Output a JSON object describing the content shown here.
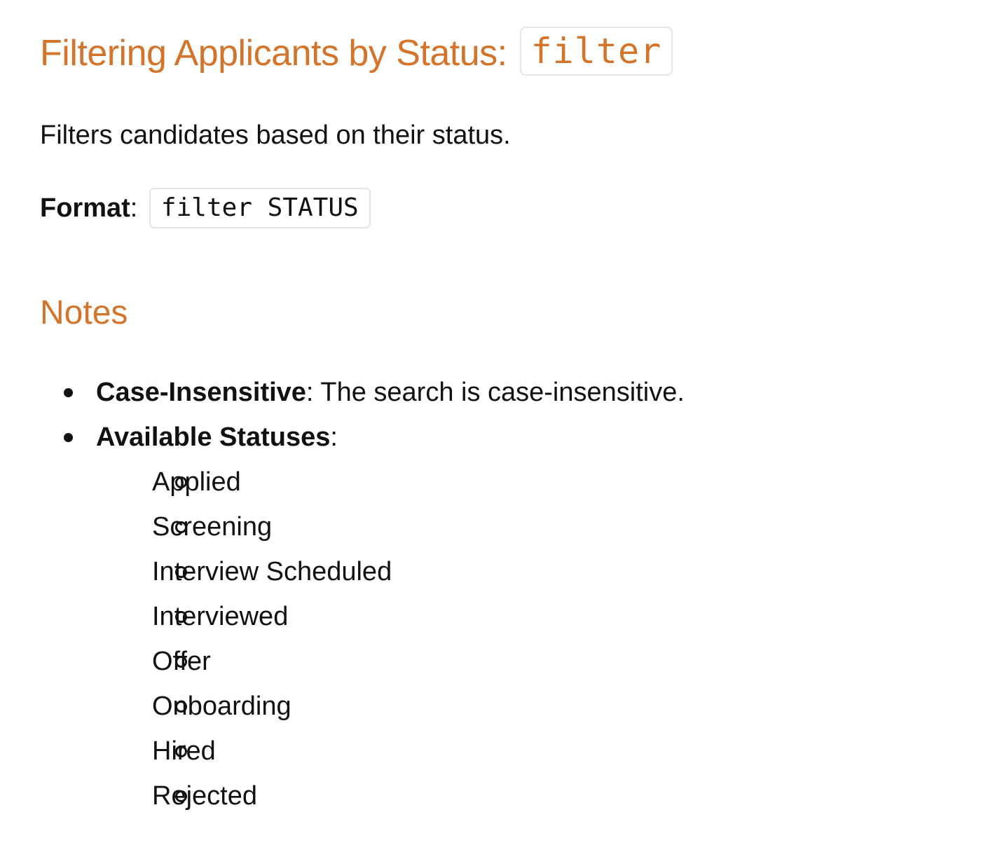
{
  "heading": {
    "text": "Filtering Applicants by Status:",
    "code": "filter"
  },
  "description": "Filters candidates based on their status.",
  "format": {
    "label": "Format",
    "separator": ":",
    "code": "filter STATUS"
  },
  "notes": {
    "title": "Notes",
    "items": [
      {
        "label": "Case-Insensitive",
        "separator": ":",
        "text": " The search is case-insensitive."
      },
      {
        "label": "Available Statuses",
        "separator": ":",
        "text": "",
        "statuses": [
          "Applied",
          "Screening",
          "Interview Scheduled",
          "Interviewed",
          "Offer",
          "Onboarding",
          "Hired",
          "Rejected"
        ]
      }
    ]
  },
  "colors": {
    "heading": "#d4742a",
    "body_text": "#111111",
    "code_border": "#e4e4e4"
  }
}
